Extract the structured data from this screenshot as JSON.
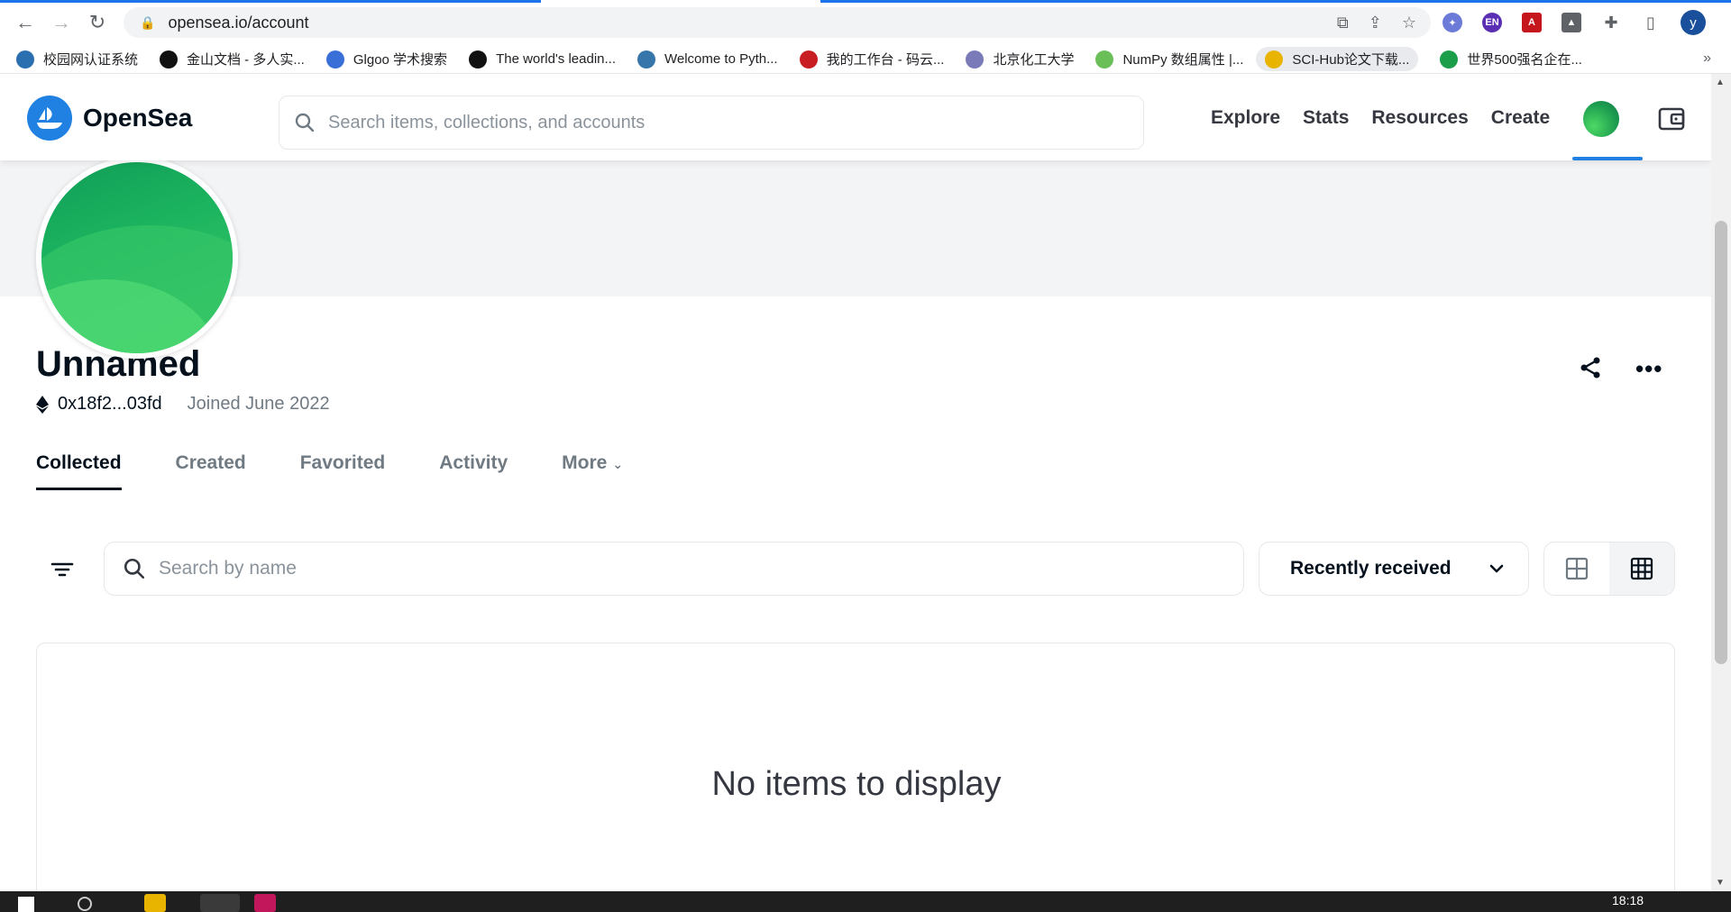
{
  "browser": {
    "url": "opensea.io/account",
    "profile_initial": "y",
    "bookmarks": [
      {
        "label": "校园网认证系统",
        "color": "#2a6fb0"
      },
      {
        "label": "金山文档 - 多人实...",
        "color": "#111111"
      },
      {
        "label": "Glgoo 学术搜索",
        "color": "#3a6fd8"
      },
      {
        "label": "The world's leadin...",
        "color": "#111111"
      },
      {
        "label": "Welcome to Pyth...",
        "color": "#3776ab"
      },
      {
        "label": "我的工作台 - 码云...",
        "color": "#c71d23"
      },
      {
        "label": "北京化工大学",
        "color": "#7a7ab8"
      },
      {
        "label": "NumPy 数组属性 |...",
        "color": "#6bbf59"
      },
      {
        "label": "SCI-Hub论文下载...",
        "color": "#e8b400"
      },
      {
        "label": "世界500强名企在...",
        "color": "#1a9e4a"
      }
    ],
    "bookmarks_more": "»"
  },
  "site": {
    "brand": "OpenSea",
    "search_placeholder": "Search items, collections, and accounts",
    "nav": [
      "Explore",
      "Stats",
      "Resources",
      "Create"
    ]
  },
  "profile": {
    "name": "Unnamed",
    "address": "0x18f2...03fd",
    "joined": "Joined June 2022"
  },
  "tabs": [
    {
      "label": "Collected",
      "active": true
    },
    {
      "label": "Created",
      "active": false
    },
    {
      "label": "Favorited",
      "active": false
    },
    {
      "label": "Activity",
      "active": false
    },
    {
      "label": "More",
      "active": false
    }
  ],
  "toolbar": {
    "search_placeholder": "Search by name",
    "sort_value": "Recently received",
    "selected_view": "compact-grid"
  },
  "items": {
    "empty_message": "No items to display"
  },
  "taskbar": {
    "time": "18:18"
  }
}
